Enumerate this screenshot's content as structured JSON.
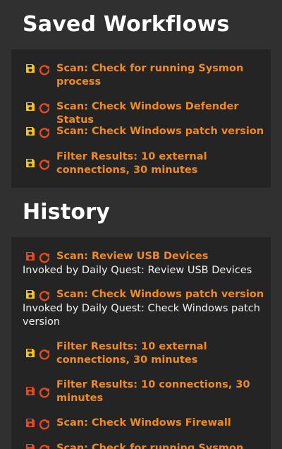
{
  "colors": {
    "background": "#303030",
    "panel": "#242424",
    "link": "#f08a24",
    "save_icon_yellow": "#f5c518",
    "save_icon_red": "#e8491d",
    "refresh_icon": "#e8491d"
  },
  "saved": {
    "title": "Saved Workflows",
    "items": [
      {
        "label": "Scan: Check for running Sysmon process",
        "save_icon": "floppy-disk-icon"
      },
      {
        "label": "Scan: Check Windows Defender Status",
        "save_icon": "floppy-disk-icon"
      },
      {
        "label": "Scan: Check Windows patch version",
        "save_icon": "floppy-disk-icon"
      },
      {
        "label": "Filter Results: 10 external connections, 30 minutes",
        "save_icon": "floppy-disk-icon"
      }
    ]
  },
  "history": {
    "title": "History",
    "items": [
      {
        "label": "Scan: Review USB Devices",
        "invoked": "Invoked by Daily Quest: Review USB Devices",
        "saved": false
      },
      {
        "label": "Scan: Check Windows patch version",
        "invoked": "Invoked by Daily Quest: Check Windows patch version",
        "saved": true
      },
      {
        "label": "Filter Results: 10 external connections, 30 minutes",
        "saved": true
      },
      {
        "label": "Filter Results: 10 connections, 30 minutes",
        "saved": false
      },
      {
        "label": "Scan: Check Windows Firewall",
        "saved": false
      },
      {
        "label": "Scan: Check for running Sysmon",
        "saved": false
      }
    ]
  }
}
